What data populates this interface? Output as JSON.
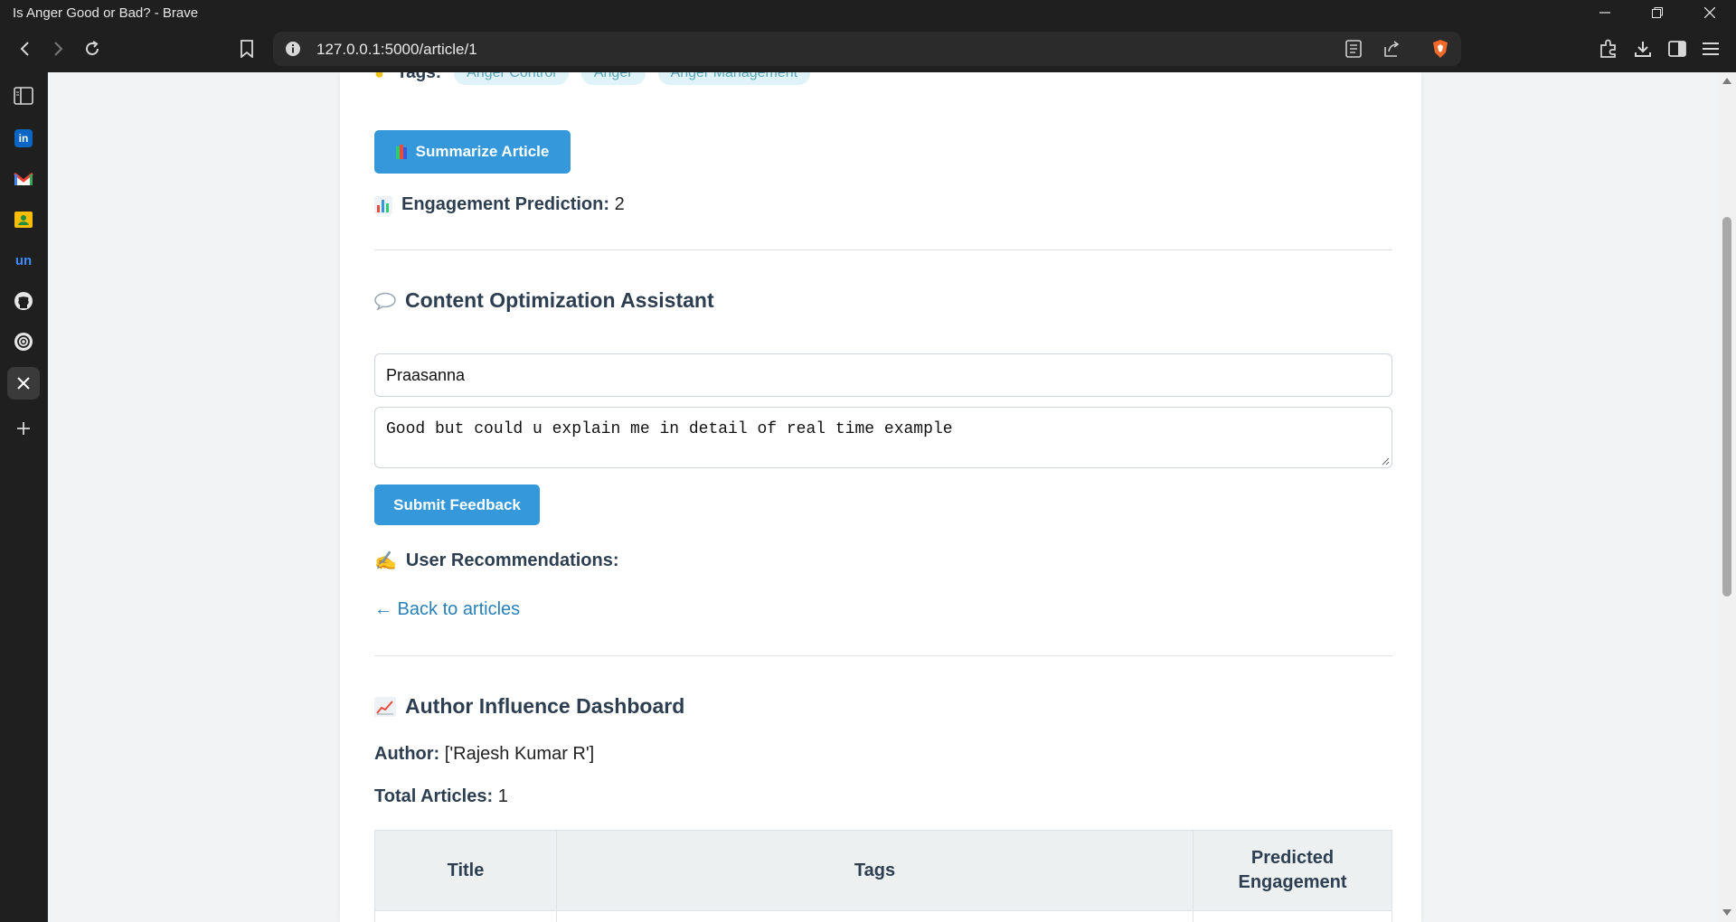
{
  "window": {
    "title": "Is Anger Good or Bad? - Brave"
  },
  "browser": {
    "url": "127.0.0.1:5000/article/1",
    "sidebar_items": [
      "sidebar-panel",
      "linkedin",
      "gmail",
      "google-contacts",
      "unstop",
      "github",
      "chatgpt",
      "x"
    ]
  },
  "colors": {
    "accent": "#3498db",
    "heading": "#2c3e50",
    "link": "#2980b9",
    "tag_bg": "#dff3f8"
  },
  "article": {
    "tags_label": "Tags:",
    "tags": [
      "Anger Control",
      "Anger",
      "Anger Management"
    ],
    "summarize_button": "Summarize Article",
    "engagement_label": "Engagement Prediction:",
    "engagement_value": "2"
  },
  "assistant": {
    "heading": "Content Optimization Assistant",
    "name_value": "Praasanna",
    "feedback_value": "Good but could u explain me in detail of real time example",
    "submit_button": "Submit Feedback",
    "recommendations_label": "User Recommendations:",
    "back_link": "← Back to articles"
  },
  "dashboard": {
    "heading": "Author Influence Dashboard",
    "author_label": "Author:",
    "author_value": "['Rajesh Kumar R']",
    "total_label": "Total Articles:",
    "total_value": "1",
    "table_headers": [
      "Title",
      "Tags",
      "Predicted Engagement"
    ]
  }
}
